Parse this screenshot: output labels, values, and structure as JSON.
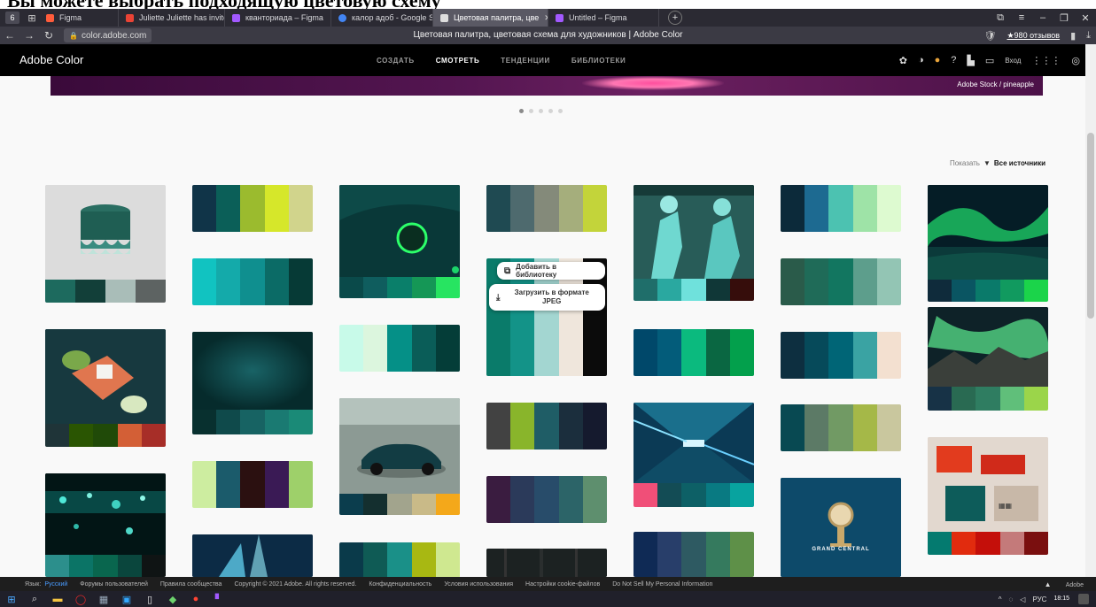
{
  "document_heading": "Вы можете выбрать подходящую цветовую схему",
  "browser": {
    "tab_count": "6",
    "tabs": [
      {
        "label": "Figma",
        "color": "#ff5c3b"
      },
      {
        "label": "Juliette Juliette has invited",
        "color": "#ea4335"
      },
      {
        "label": "кванториада – Figma",
        "color": "#a259ff"
      },
      {
        "label": "калор адоб - Google Sear",
        "color": "#4285f4"
      },
      {
        "label": "Цветовая палитра, цве",
        "color": "#ffffff"
      },
      {
        "label": "Untitled – Figma",
        "color": "#a259ff"
      }
    ],
    "address": "color.adobe.com",
    "page_title": "Цветовая палитра, цветовая схема для художников | Adobe Color",
    "reviews": "★980 отзывов"
  },
  "adobe_nav": {
    "brand": "Adobe Color",
    "tabs": [
      "СОЗДАТЬ",
      "СМОТРЕТЬ",
      "ТЕНДЕНЦИИ",
      "БИБЛИОТЕКИ"
    ],
    "active_tab": "СМОТРЕТЬ",
    "login": "Вход"
  },
  "banner": {
    "credit": "Adobe Stock / pineapple"
  },
  "carousel_dots": 5,
  "filter": {
    "label": "Показать",
    "value": "Все источники"
  },
  "context_menu": {
    "add_to_library": "Добавить в библиотеку",
    "download_line1": "Загрузить в формате",
    "download_line2": "JPEG"
  },
  "cards": [
    {
      "colors": [
        "#1d6a5e",
        "#123f39",
        "#a9bdb8",
        "#5d6362"
      ],
      "image": "teal-stool",
      "bg": "#dcdcdc"
    },
    {
      "colors": [
        "#103448",
        "#0b5f58",
        "#9bbb2e",
        "#d6e72a",
        "#d1d48c"
      ]
    },
    {
      "colors": [
        "#0a4a4a",
        "#0f5d5e",
        "#0a7f6a",
        "#159756",
        "#27e461"
      ],
      "image": "green-planet",
      "bg": "#0b3b3b"
    },
    {
      "colors": [
        "#1f4a52",
        "#4e6a6e",
        "#848a7a",
        "#a5ae7c",
        "#c3d43a"
      ]
    },
    {
      "colors": [
        "#1f6e6a",
        "#2aa8a0",
        "#6fe1dc",
        "#103737",
        "#360d0b"
      ],
      "image": "street-art",
      "bg": "#1b4f4c"
    },
    {
      "colors": [
        "#0c2a3a",
        "#1d6a91",
        "#4cc2b1",
        "#9ee3a7",
        "#ddfad0"
      ]
    },
    {
      "colors": [
        "#0f2b3b",
        "#0a5562",
        "#0a7a6a",
        "#119a5f",
        "#1bd44a"
      ],
      "image": "aurora",
      "bg": "#062929"
    },
    {
      "colors": [
        "#11c3c1",
        "#14aaaa",
        "#0f8f8f",
        "#0b6b66",
        "#063a36"
      ]
    },
    {
      "colors": [
        "#2a5b4a",
        "#1f6b58",
        "#127660",
        "#5d9e8c",
        "#93c5b4"
      ]
    },
    {
      "colors": [
        "#173246",
        "#296a52",
        "#2f7d61",
        "#60bf7a",
        "#9bd54a"
      ],
      "image": "aurora-mountains",
      "bg": "#17322d"
    },
    {
      "colors": [
        "#1f3438",
        "#2a5502",
        "#204a08",
        "#d35f36",
        "#a72e28"
      ],
      "image": "salt-plant",
      "bg": "#17393f"
    },
    {
      "colors": [
        "#08302f",
        "#0f4a4b",
        "#176363",
        "#1a7a72",
        "#1a8a77"
      ],
      "image": "dark-teal-texture",
      "bg": "#0e3b3d"
    },
    {
      "colors": [
        "#c8fae9",
        "#dcf6de",
        "#059087",
        "#0a5d58",
        "#043d38"
      ]
    },
    {
      "colors": [
        "#0a7b6a",
        "#139388",
        "#a3d6d1",
        "#efe6dc",
        "#0b0b0b"
      ]
    },
    {
      "colors": [
        "#00486a",
        "#035c7a",
        "#0bba7e",
        "#0a6742",
        "#03a04c"
      ]
    },
    {
      "colors": [
        "#0d2f40",
        "#064a5a",
        "#006576",
        "#3aa3a3",
        "#f3e0d0"
      ]
    },
    {
      "colors": [
        "#424242",
        "#89b52b",
        "#1f5d66",
        "#1b2e3d",
        "#151a2e"
      ]
    },
    {
      "colors": [
        "#084952",
        "#5c7a66",
        "#719a64",
        "#a5b848",
        "#c9c79e"
      ]
    },
    {
      "colors": [
        "#f04f78",
        "#134c55",
        "#0d6066",
        "#097a82",
        "#08a39f"
      ],
      "image": "tunnel",
      "bg": "#0b3a55"
    },
    {
      "colors": [
        "#0b3d4d",
        "#142f2f",
        "#a2a48d",
        "#c9ba88",
        "#f4a81a"
      ],
      "image": "car",
      "bg": "#7e8e88"
    },
    {
      "colors": [
        "#cdeda0",
        "#1b5b6b",
        "#2b1010",
        "#3a1a55",
        "#9ed06a"
      ]
    },
    {
      "colors": [
        "#3a1c40",
        "#2b3a5a",
        "#284c6a",
        "#2c6468",
        "#5e8f6e"
      ]
    },
    {
      "colors": [
        "#047a6f",
        "#e12b0e",
        "#c40f0a",
        "#c47a7a",
        "#7a0f0f"
      ],
      "image": "red-paper",
      "bg": "#d8d0c8"
    },
    {
      "colors": [
        "#0a3a4a",
        "#0f5b55",
        "#1a9088",
        "#a8b812",
        "#cfe890"
      ]
    },
    {
      "colors": [
        "#0f2a55",
        "#283e6a",
        "#2e5a62",
        "#357a5e",
        "#5e9048"
      ]
    },
    {
      "colors": [
        "#2c8f8c",
        "#0b7466",
        "#09664e",
        "#0a463d",
        "#0f1414"
      ],
      "image": "bokeh",
      "bg": "#021515"
    },
    {
      "colors": [
        "#0f3a5a"
      ],
      "image": "aurora-blue",
      "bg": "#0c2b45"
    },
    {
      "colors": [
        "#1a2020"
      ],
      "image": "dark-forest",
      "bg": "#1c2222"
    },
    {
      "colors": [
        "#0d4a6a"
      ],
      "image": "grand-central",
      "bg": "#0d4a6a"
    }
  ],
  "grand_central_label": "GRAND CENTRAL",
  "footer": {
    "lang_label": "Язык:",
    "lang_value": "Русский",
    "links": [
      "Форумы пользователей",
      "Правила сообщества",
      "Copyright © 2021 Adobe. All rights reserved.",
      "Конфиденциальность",
      "Условия использования",
      "Настройки cookie-файлов",
      "Do Not Sell My Personal Information"
    ],
    "adobe": "Adobe"
  },
  "taskbar": {
    "lang": "РУС",
    "time": "18:15"
  }
}
